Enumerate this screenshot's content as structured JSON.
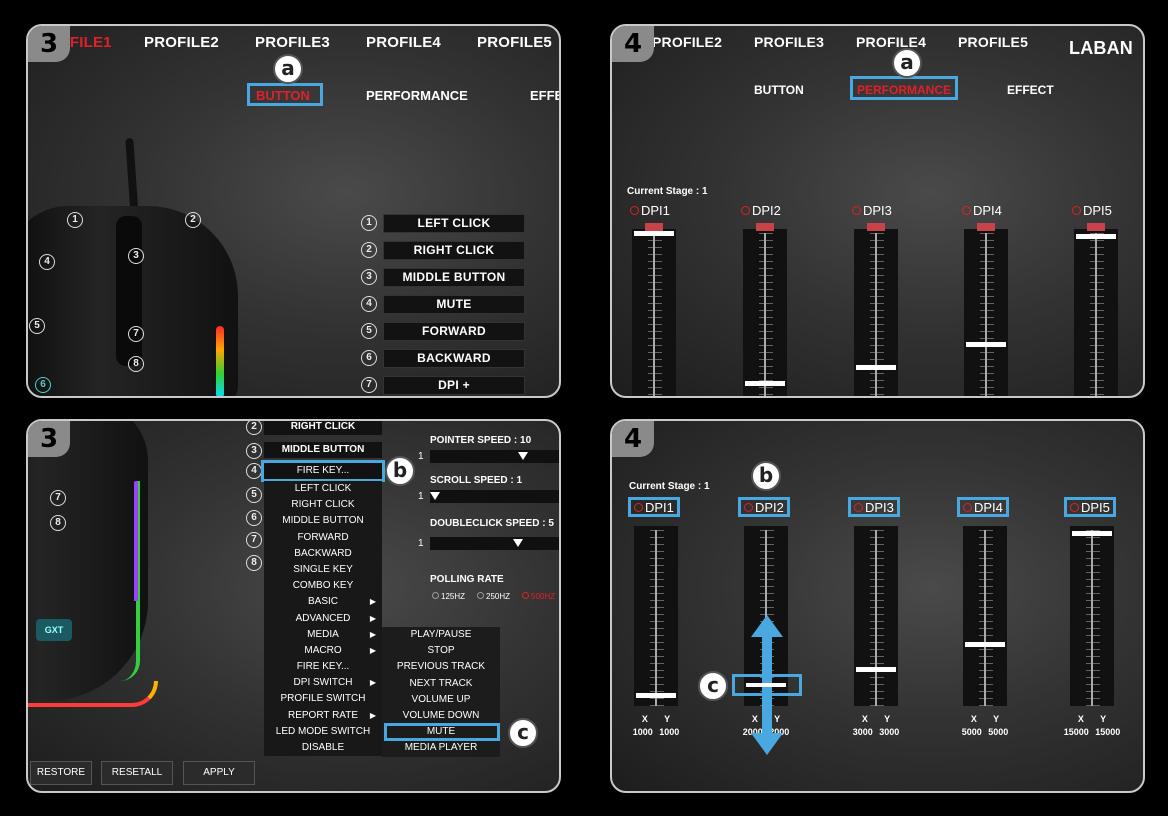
{
  "panel1": {
    "step": "3",
    "tabs": [
      "OFILE1",
      "PROFILE2",
      "PROFILE3",
      "PROFILE4",
      "PROFILE5"
    ],
    "subtabs": [
      "BUTTON",
      "PERFORMANCE",
      "EFFE"
    ],
    "callout": "a",
    "mouse_numbers": [
      "1",
      "2",
      "3",
      "4",
      "5",
      "7",
      "8",
      "6"
    ],
    "buttons": [
      {
        "num": "1",
        "label": "LEFT CLICK"
      },
      {
        "num": "2",
        "label": "RIGHT CLICK"
      },
      {
        "num": "3",
        "label": "MIDDLE BUTTON"
      },
      {
        "num": "4",
        "label": "MUTE"
      },
      {
        "num": "5",
        "label": "FORWARD"
      },
      {
        "num": "6",
        "label": "BACKWARD"
      },
      {
        "num": "7",
        "label": "DPI +"
      }
    ]
  },
  "panel2": {
    "step": "4",
    "tabs": [
      "PROFILE2",
      "PROFILE3",
      "PROFILE4",
      "PROFILE5"
    ],
    "lang": "LABAN",
    "subtabs": [
      "BUTTON",
      "PERFORMANCE",
      "EFFECT"
    ],
    "callout": "a",
    "current_stage": "Current Stage : 1",
    "dpi": [
      {
        "label": "DPI1",
        "level": 1.0
      },
      {
        "label": "DPI2",
        "level": 0.05
      },
      {
        "label": "DPI3",
        "level": 0.15
      },
      {
        "label": "DPI4",
        "level": 0.3
      },
      {
        "label": "DPI5",
        "level": 0.98
      }
    ]
  },
  "panel3": {
    "step": "3",
    "mouse_numbers": [
      "7",
      "8"
    ],
    "mouse_logo": "GXT",
    "list_numbers": [
      "2",
      "3",
      "4",
      "5",
      "6",
      "7",
      "8"
    ],
    "list_items": [
      "RIGHT CLICK",
      "MIDDLE BUTTON",
      "FIRE KEY..."
    ],
    "menu": [
      {
        "label": "LEFT CLICK",
        "sub": false
      },
      {
        "label": "RIGHT CLICK",
        "sub": false
      },
      {
        "label": "MIDDLE BUTTON",
        "sub": false
      },
      {
        "label": "FORWARD",
        "sub": false
      },
      {
        "label": "BACKWARD",
        "sub": false
      },
      {
        "label": "SINGLE KEY",
        "sub": false
      },
      {
        "label": "COMBO KEY",
        "sub": false
      },
      {
        "label": "BASIC",
        "sub": true
      },
      {
        "label": "ADVANCED",
        "sub": true
      },
      {
        "label": "MEDIA",
        "sub": true
      },
      {
        "label": "MACRO",
        "sub": true
      },
      {
        "label": "FIRE KEY...",
        "sub": false
      },
      {
        "label": "DPI SWITCH",
        "sub": true
      },
      {
        "label": "PROFILE SWITCH",
        "sub": false
      },
      {
        "label": "REPORT RATE",
        "sub": true
      },
      {
        "label": "LED MODE SWITCH",
        "sub": false
      },
      {
        "label": "DISABLE",
        "sub": false
      }
    ],
    "media_menu": [
      "PLAY/PAUSE",
      "STOP",
      "PREVIOUS TRACK",
      "NEXT TRACK",
      "VOLUME UP",
      "VOLUME DOWN",
      "MUTE",
      "MEDIA PLAYER"
    ],
    "callout_b": "b",
    "callout_c": "c",
    "pointer_speed": "POINTER SPEED : 10",
    "scroll_speed": "SCROLL SPEED : 1",
    "doubleclick_speed": "DOUBLECLICK SPEED : 5",
    "slider_min": "1",
    "polling_rate": "POLLING RATE",
    "polling_options": [
      "125HZ",
      "250HZ",
      "500HZ"
    ],
    "bottom_buttons": [
      "RESTORE",
      "RESETALL",
      "APPLY"
    ]
  },
  "panel4": {
    "step": "4",
    "current_stage": "Current Stage : 1",
    "callout_b": "b",
    "callout_c": "c",
    "dpi": [
      {
        "label": "DPI1",
        "level": 0.03,
        "x": "1000",
        "y": "1000"
      },
      {
        "label": "DPI2",
        "level": 0.06,
        "x": "2000",
        "y": "2000"
      },
      {
        "label": "DPI3",
        "level": 0.18,
        "x": "3000",
        "y": "3000"
      },
      {
        "label": "DPI4",
        "level": 0.33,
        "x": "5000",
        "y": "5000"
      },
      {
        "label": "DPI5",
        "level": 0.98,
        "x": "15000",
        "y": "15000"
      }
    ],
    "axis_x": "X",
    "axis_y": "Y"
  }
}
